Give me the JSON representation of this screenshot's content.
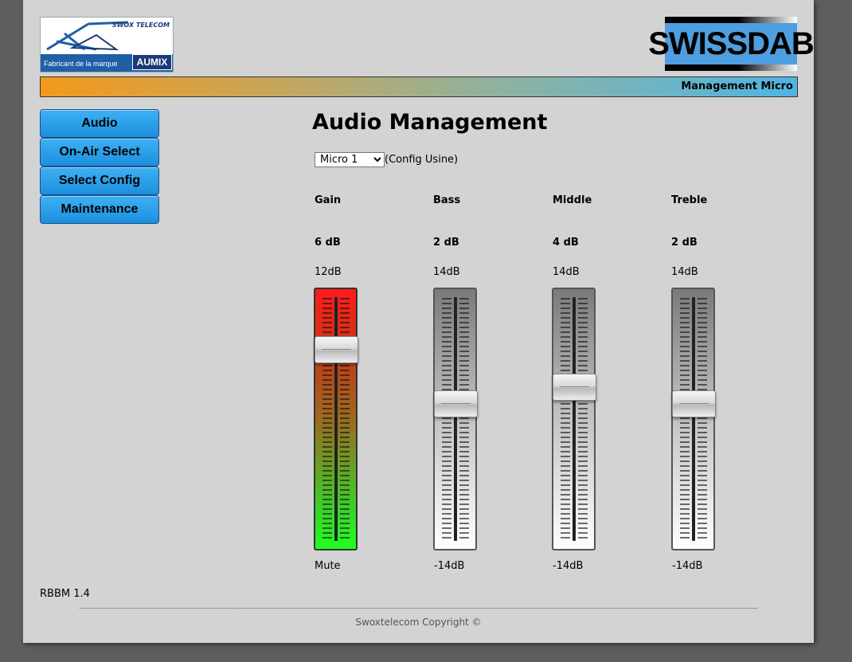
{
  "header": {
    "left_logo": {
      "brand": "SWOX TELECOM",
      "caption": "Fabricant de la marque",
      "mark": "AUMIX"
    },
    "right_logo": {
      "text": "SWISSDAB"
    },
    "banner_text": "Management Micro"
  },
  "nav": [
    {
      "label": "Audio"
    },
    {
      "label": "On-Air Select"
    },
    {
      "label": "Select Config"
    },
    {
      "label": "Maintenance"
    }
  ],
  "main": {
    "title": "Audio Management",
    "preset": {
      "selected": "Micro 1",
      "options": [
        "Micro 1"
      ],
      "note": "(Config Usine)"
    },
    "channels": [
      {
        "name": "Gain",
        "value": "6 dB",
        "max": "12dB",
        "min": "Mute",
        "level": 0.806,
        "style": "red"
      },
      {
        "name": "Bass",
        "value": "2 dB",
        "max": "14dB",
        "min": "-14dB",
        "level": 0.571,
        "style": "grey"
      },
      {
        "name": "Middle",
        "value": "4 dB",
        "max": "14dB",
        "min": "-14dB",
        "level": 0.643,
        "style": "grey"
      },
      {
        "name": "Treble",
        "value": "2 dB",
        "max": "14dB",
        "min": "-14dB",
        "level": 0.571,
        "style": "grey"
      }
    ]
  },
  "footer": {
    "version": "RBBM 1.4",
    "copyright": "Swoxtelecom Copyright ©"
  }
}
